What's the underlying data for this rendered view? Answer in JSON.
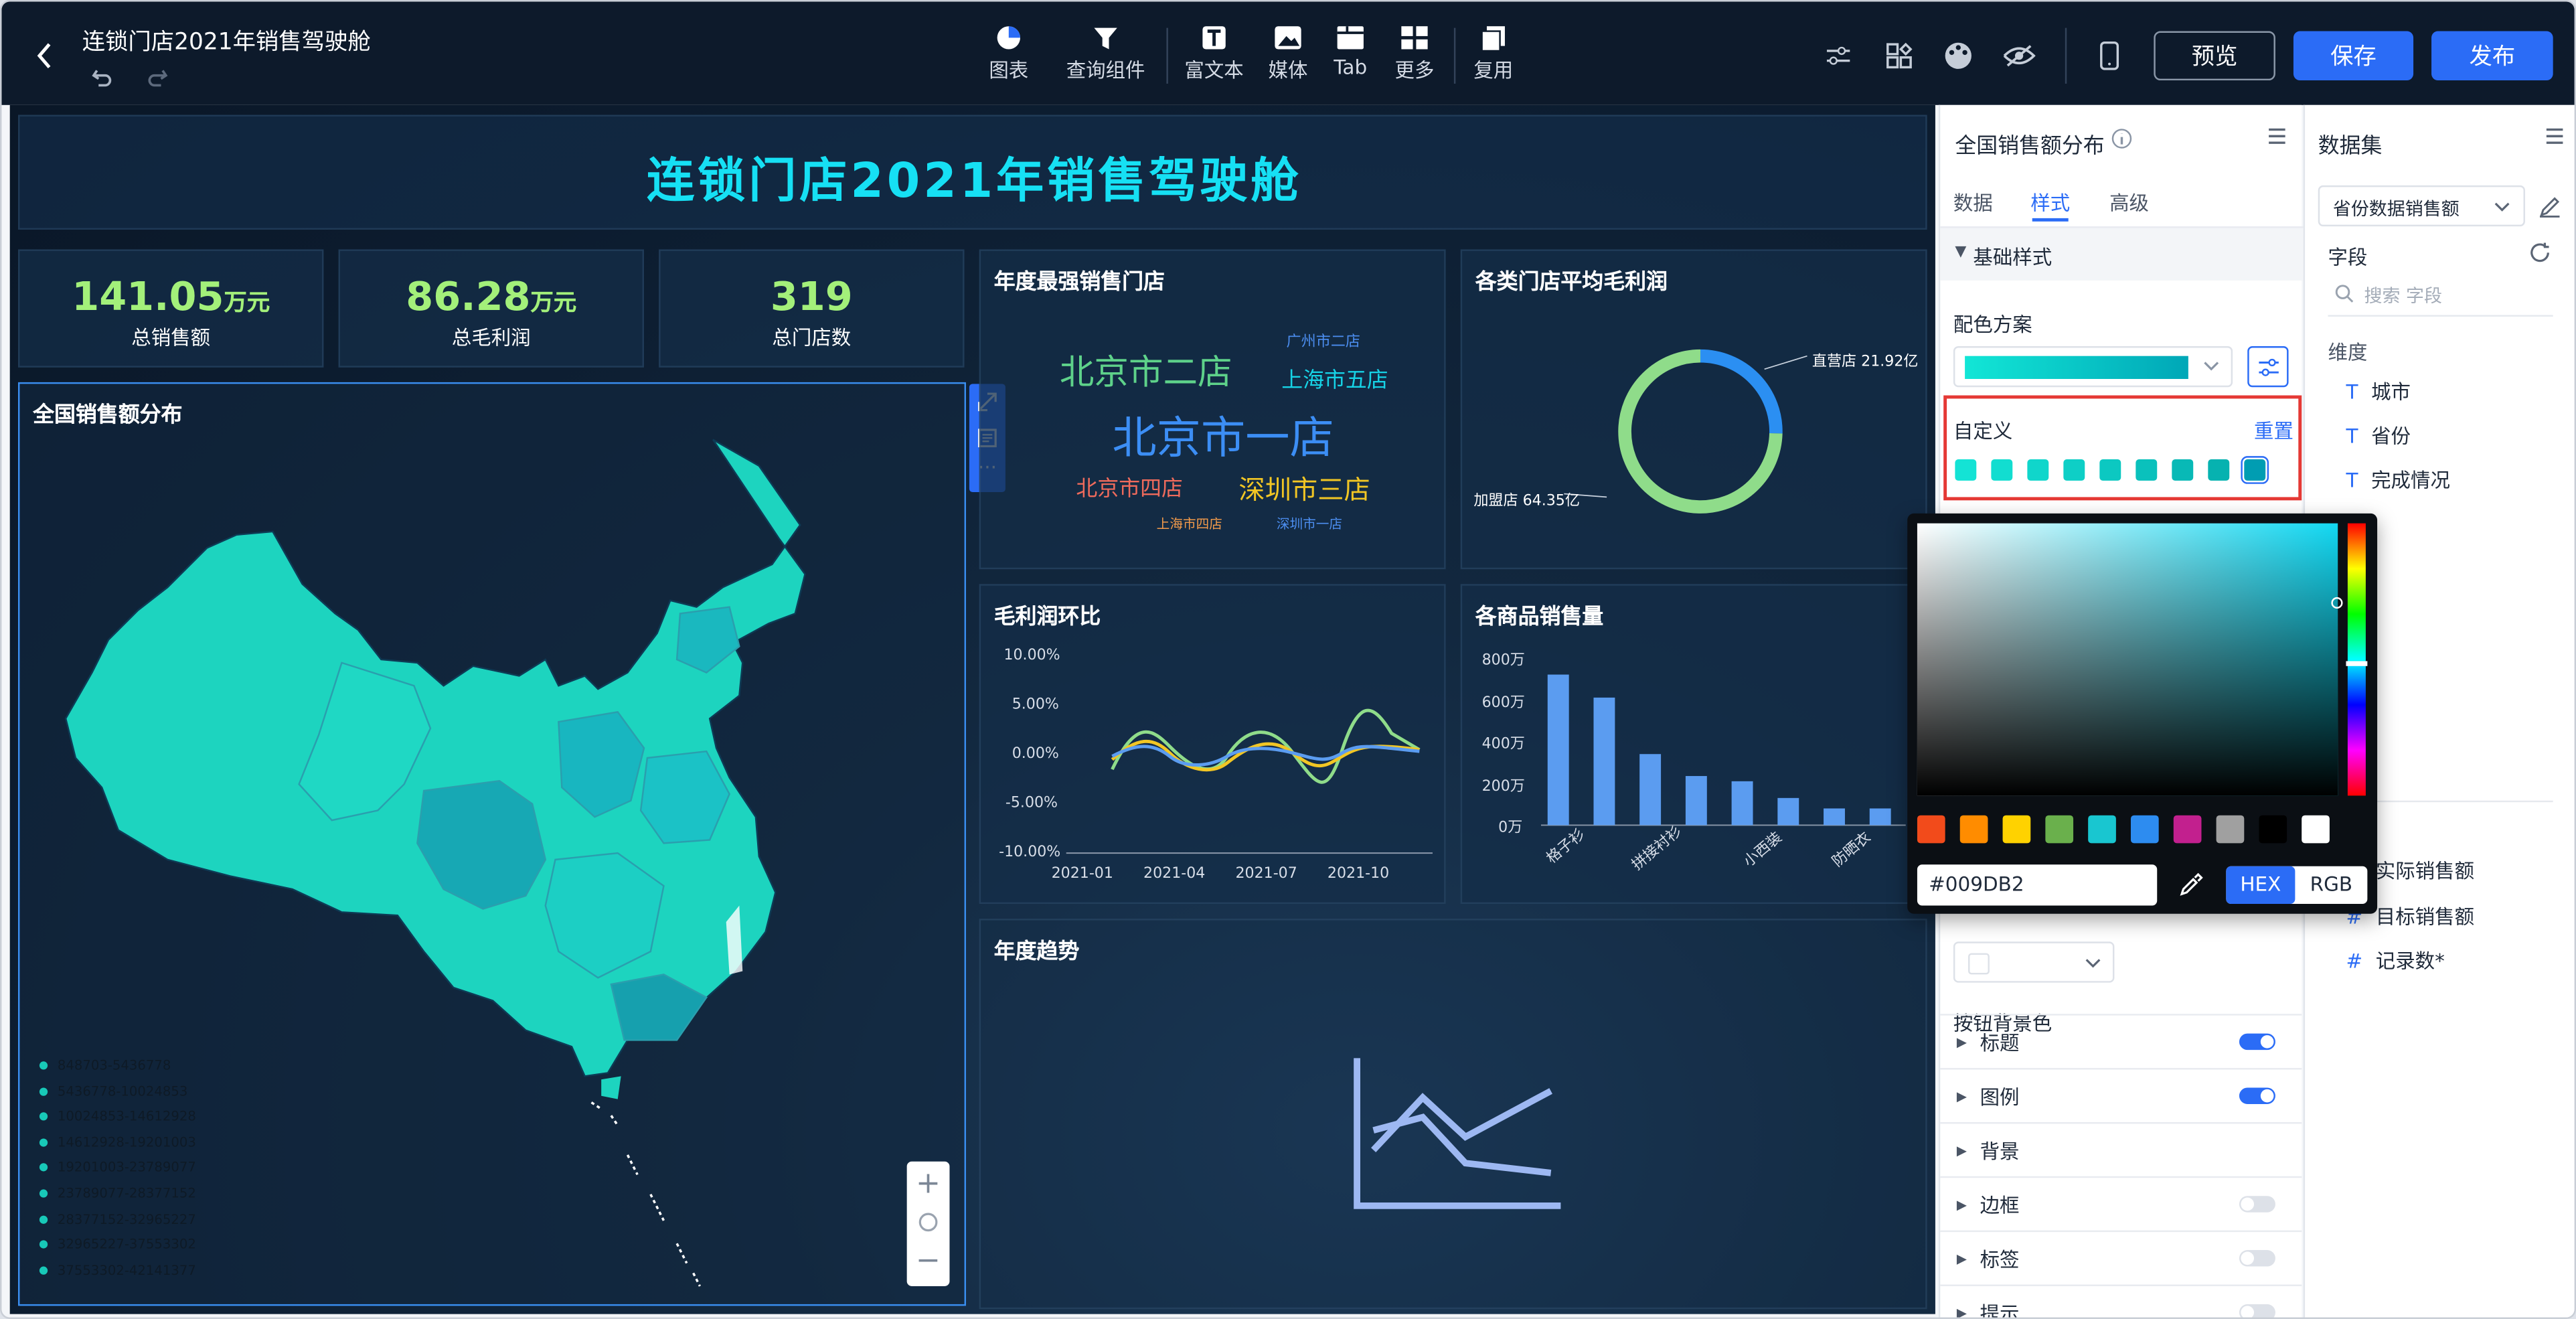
{
  "window": {
    "title": "连锁门店2021年销售驾驶舱"
  },
  "toolbar": {
    "tools": [
      "图表",
      "查询组件",
      "富文本",
      "媒体",
      "Tab",
      "更多",
      "复用"
    ],
    "preview": "预览",
    "save": "保存",
    "publish": "发布"
  },
  "dashboard": {
    "title": "连锁门店2021年销售驾驶舱",
    "kpis": [
      {
        "value": "141.05",
        "unit": "万元",
        "label": "总销售额"
      },
      {
        "value": "86.28",
        "unit": "万元",
        "label": "总毛利润"
      },
      {
        "value": "319",
        "unit": "",
        "label": "总门店数"
      }
    ],
    "map": {
      "title": "全国销售额分布",
      "legend": [
        "848703-5436778",
        "5436778-10024853",
        "10024853-14612928",
        "14612928-19201003",
        "19201003-23789077",
        "23789077-28377152",
        "28377152-32965227",
        "32965227-37553302",
        "37553302-42141377"
      ]
    },
    "wordcloud": {
      "title": "年度最强销售门店",
      "words": [
        "北京市二店",
        "广州市二店",
        "上海市五店",
        "北京市一店",
        "北京市四店",
        "深圳市三店",
        "上海市四店",
        "深圳市一店"
      ]
    },
    "donut": {
      "title": "各类门店平均毛利润",
      "slices": [
        {
          "name": "直营店",
          "label": "直营店 21.92亿",
          "value": 21.92
        },
        {
          "name": "加盟店",
          "label": "加盟店 64.35亿",
          "value": 64.35
        }
      ]
    },
    "line": {
      "title": "毛利润环比",
      "y_ticks": [
        "10.00%",
        "5.00%",
        "0.00%",
        "-5.00%",
        "-10.00%"
      ],
      "x_ticks": [
        "2021-01",
        "2021-04",
        "2021-07",
        "2021-10"
      ]
    },
    "bar": {
      "title": "各商品销售量",
      "y_ticks": [
        "800万",
        "600万",
        "400万",
        "200万",
        "0万"
      ],
      "x_ticks": [
        "格子衫",
        "拼接衬衫",
        "小西装",
        "防晒衣"
      ]
    },
    "trend": {
      "title": "年度趋势"
    }
  },
  "chart_data": [
    {
      "type": "pie",
      "title": "各类门店平均毛利润",
      "categories": [
        "直营店",
        "加盟店"
      ],
      "values": [
        21.92,
        64.35
      ]
    },
    {
      "type": "bar",
      "title": "各商品销售量",
      "ylim": [
        0,
        800
      ],
      "values": [
        720,
        610,
        340,
        235,
        210,
        130,
        80,
        80
      ]
    },
    {
      "type": "line",
      "title": "毛利润环比",
      "x": [
        "2021-01",
        "2021-04",
        "2021-07",
        "2021-10"
      ],
      "ylim": [
        -10,
        10
      ]
    }
  ],
  "style_panel": {
    "chart_name": "全国销售额分布",
    "tabs": [
      "数据",
      "样式",
      "高级"
    ],
    "section": "基础样式",
    "palette_label": "配色方案",
    "custom_label": "自定义",
    "reset": "重置",
    "bg_label": "按钮背景色",
    "collapsed": [
      {
        "label": "标题",
        "on": true
      },
      {
        "label": "图例",
        "on": true
      },
      {
        "label": "背景",
        "on": null
      },
      {
        "label": "边框",
        "on": false
      },
      {
        "label": "标签",
        "on": false
      },
      {
        "label": "提示",
        "on": false
      }
    ]
  },
  "color_picker": {
    "hex": "#009DB2",
    "mode_hex": "HEX",
    "mode_rgb": "RGB",
    "presets": [
      "#f24b1b",
      "#ff8c00",
      "#ffd200",
      "#6ab04c",
      "#19c6d0",
      "#2d8cf0",
      "#c2208e",
      "#a0a0a0",
      "#000000",
      "#ffffff"
    ]
  },
  "dataset": {
    "title": "数据集",
    "selected": "省份数据销售额",
    "field_label": "字段",
    "search_placeholder": "搜索 字段",
    "dim_label": "维度",
    "dims": [
      "城市",
      "省份",
      "完成情况"
    ],
    "measures": [
      "实际销售额",
      "目标销售额",
      "记录数*"
    ]
  }
}
